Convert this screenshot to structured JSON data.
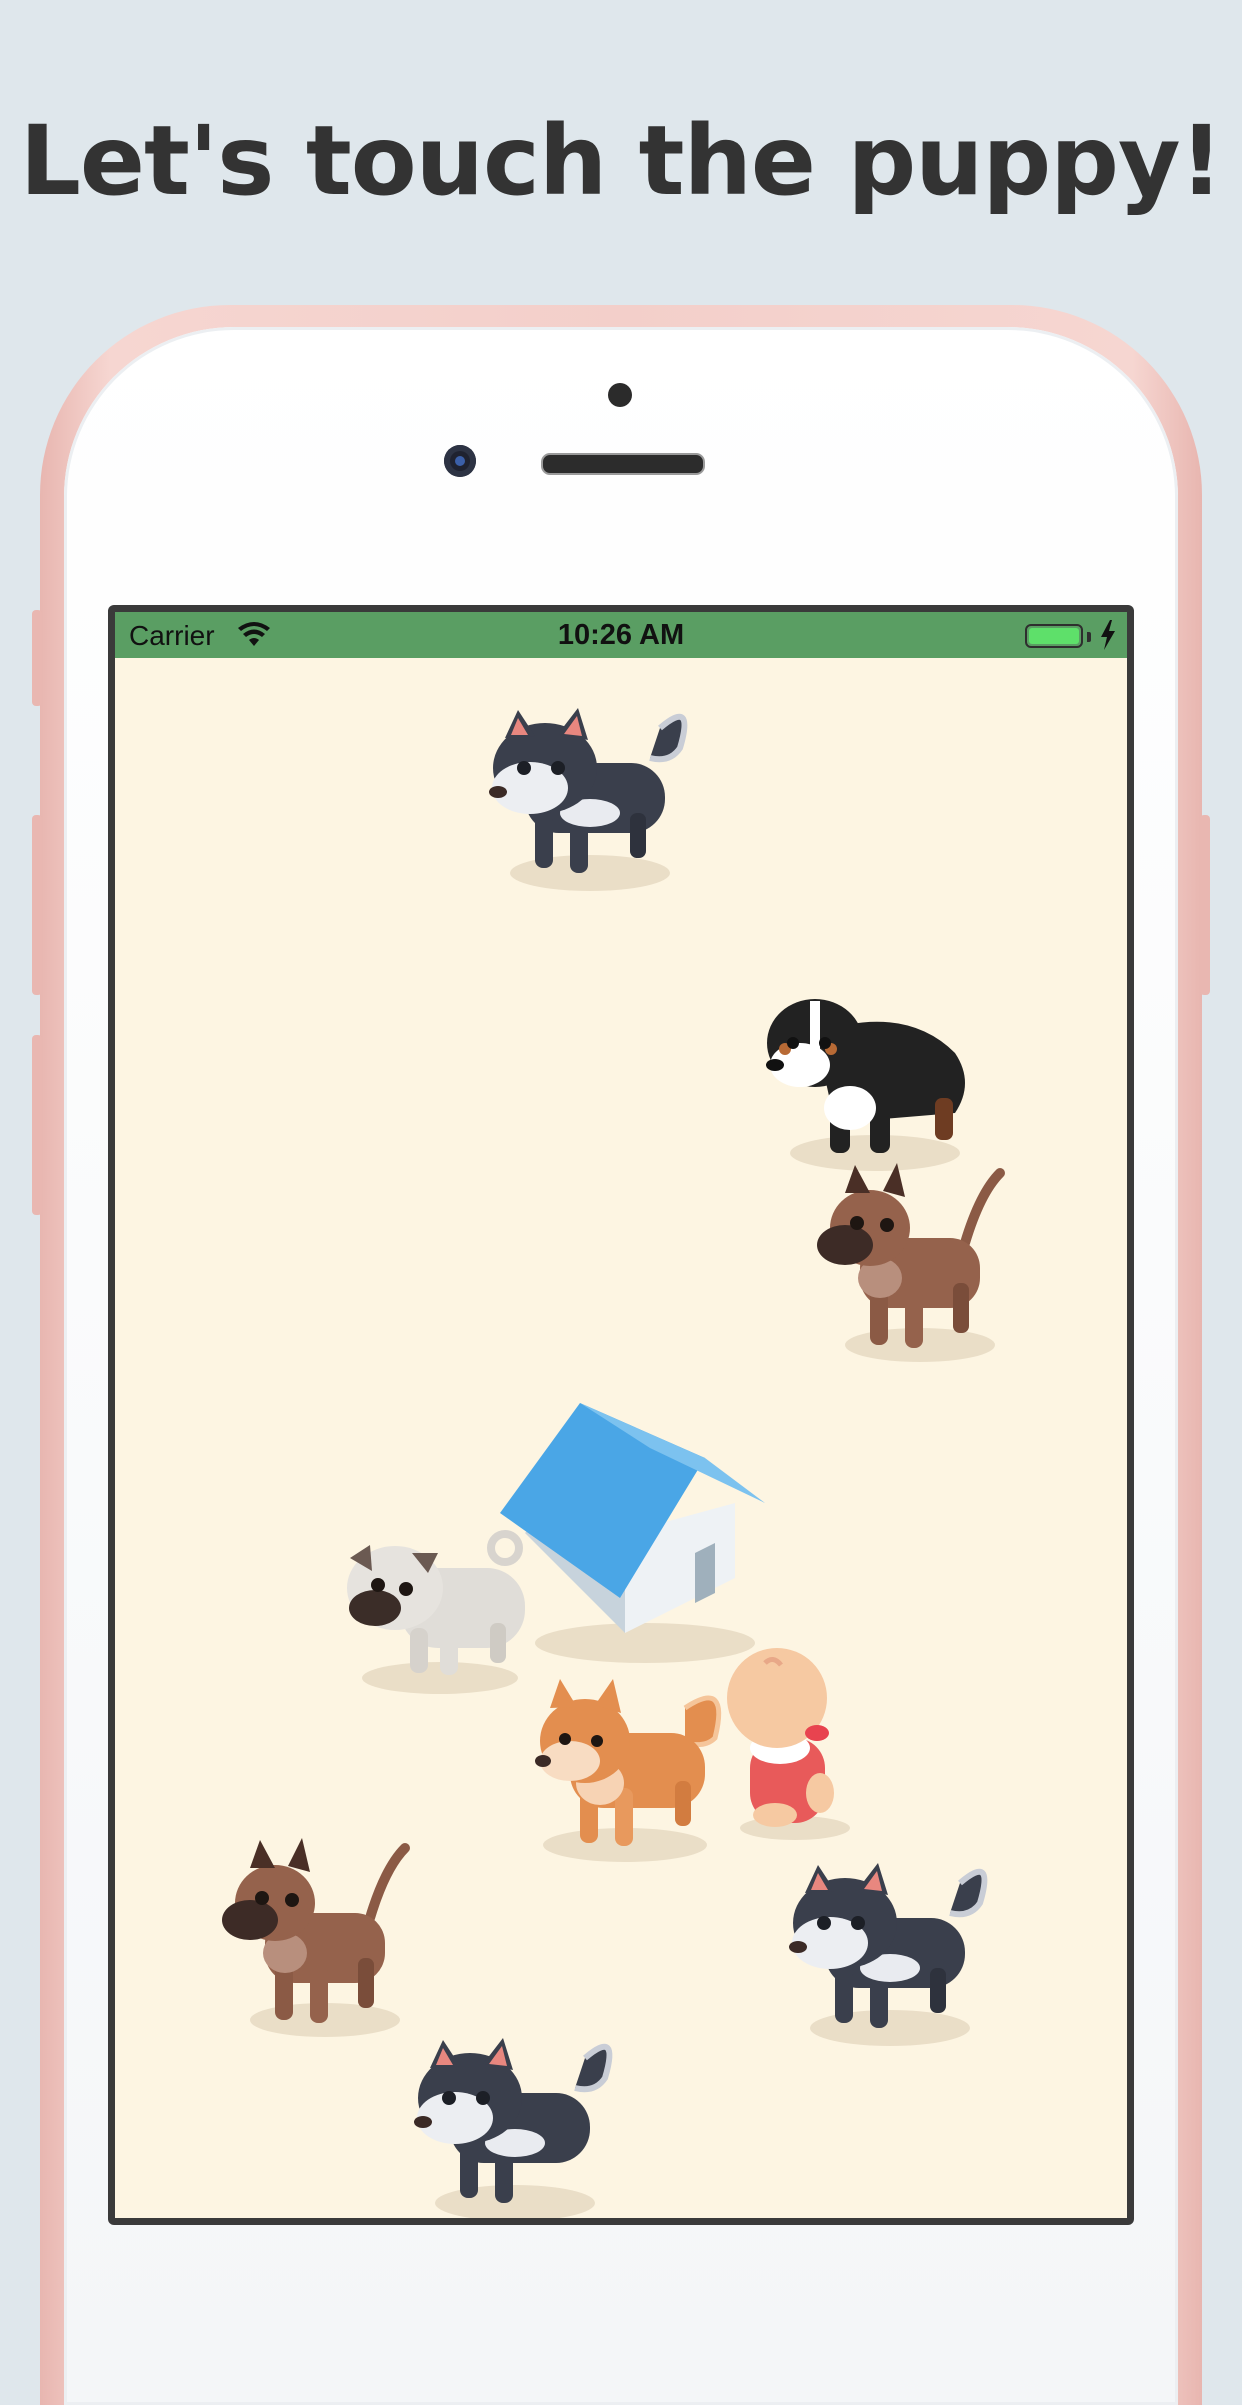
{
  "headline": "Let's touch the puppy!",
  "status_bar": {
    "carrier": "Carrier",
    "time": "10:26 AM",
    "wifi_icon": "wifi-icon",
    "battery_icon": "battery-icon",
    "charging_icon": "charging-bolt-icon"
  },
  "colors": {
    "background": "#dfe7ec",
    "status_bar": "#5a9e63",
    "game_area": "#fdf5e2",
    "phone_frame": "#f3cfca",
    "doghouse_roof": "#4aa6e6"
  },
  "characters": [
    {
      "name": "husky-puppy"
    },
    {
      "name": "bernese-puppy"
    },
    {
      "name": "brown-puppy"
    },
    {
      "name": "doghouse"
    },
    {
      "name": "pug-puppy"
    },
    {
      "name": "shiba-puppy"
    },
    {
      "name": "baby"
    },
    {
      "name": "brown-puppy"
    },
    {
      "name": "husky-puppy"
    },
    {
      "name": "husky-puppy"
    }
  ]
}
